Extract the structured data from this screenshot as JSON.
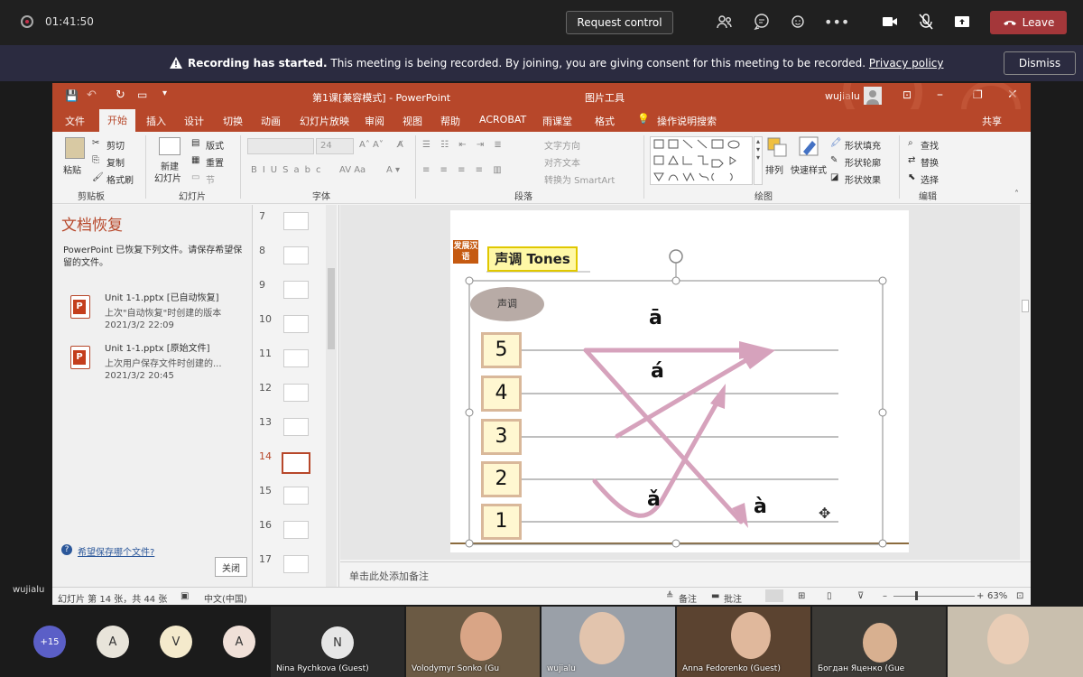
{
  "topbar": {
    "timer": "01:41:50",
    "request_control": "Request control",
    "leave": "Leave"
  },
  "banner": {
    "bold": "Recording has started.",
    "text": " This meeting is being recorded. By joining, you are giving consent for this meeting to be recorded. ",
    "link": "Privacy policy",
    "dismiss": "Dismiss"
  },
  "ppt": {
    "title": "第1课[兼容模式]  -  PowerPoint",
    "picture_tools": "图片工具",
    "user": "wujialu",
    "tabs": [
      "文件",
      "开始",
      "插入",
      "设计",
      "切换",
      "动画",
      "幻灯片放映",
      "审阅",
      "视图",
      "帮助",
      "ACROBAT",
      "雨课堂",
      "格式"
    ],
    "tell_me": "操作说明搜索",
    "share": "共享",
    "ribbon": {
      "paste": "粘贴",
      "cut": "剪切",
      "copy": "复制",
      "format_painter": "格式刷",
      "clipboard": "剪贴板",
      "new_slide_1": "新建",
      "new_slide_2": "幻灯片",
      "layout": "版式",
      "reset": "重置",
      "section": "节",
      "slides": "幻灯片",
      "font_size": "24",
      "font": "字体",
      "text_direction": "文字方向",
      "align_text": "对齐文本",
      "smartart": "转换为 SmartArt",
      "paragraph": "段落",
      "arrange": "排列",
      "quick_styles": "快速样式",
      "shape_fill": "形状填充",
      "shape_outline": "形状轮廓",
      "shape_effects": "形状效果",
      "drawing": "绘图",
      "find": "查找",
      "replace": "替换",
      "select": "选择",
      "editing": "编辑"
    },
    "recovery": {
      "title": "文档恢复",
      "desc": "PowerPoint 已恢复下列文件。请保存希望保留的文件。",
      "files": [
        {
          "name": "Unit 1-1.pptx  [已自动恢复]",
          "sub": "上次\"自动恢复\"时创建的版本",
          "date": "2021/3/2 22:09"
        },
        {
          "name": "Unit 1-1.pptx  [原始文件]",
          "sub": "上次用户保存文件时创建的...",
          "date": "2021/3/2 20:45"
        }
      ],
      "help": "希望保存哪个文件?",
      "close": "关闭"
    },
    "thumb_numbers": [
      "7",
      "8",
      "9",
      "10",
      "11",
      "12",
      "13",
      "14",
      "15",
      "16",
      "17"
    ],
    "slide": {
      "badge": "发展汉语",
      "heading": "声调 Tones",
      "oval": "声调",
      "levels": [
        "5",
        "4",
        "3",
        "2",
        "1"
      ],
      "tone1": "ā",
      "tone2": "á",
      "tone3": "ǎ",
      "tone4": "à"
    },
    "notes": "单击此处添加备注",
    "status": {
      "slide_count": "幻灯片 第 14 张，共 44 张",
      "language": "中文(中国)",
      "notes": "备注",
      "comments": "批注",
      "zoom": "63%"
    }
  },
  "side_label": "wujialu",
  "participants": {
    "more": "+15",
    "avatars": [
      "A",
      "V",
      "A"
    ],
    "nina_initial": "N",
    "tiles": [
      "Nina Rychkova (Guest)",
      "Volodymyr Sonko (Gu",
      "wujialu",
      "Anna Fedorenko (Guest)",
      "Богдан Яценко (Gue"
    ]
  }
}
